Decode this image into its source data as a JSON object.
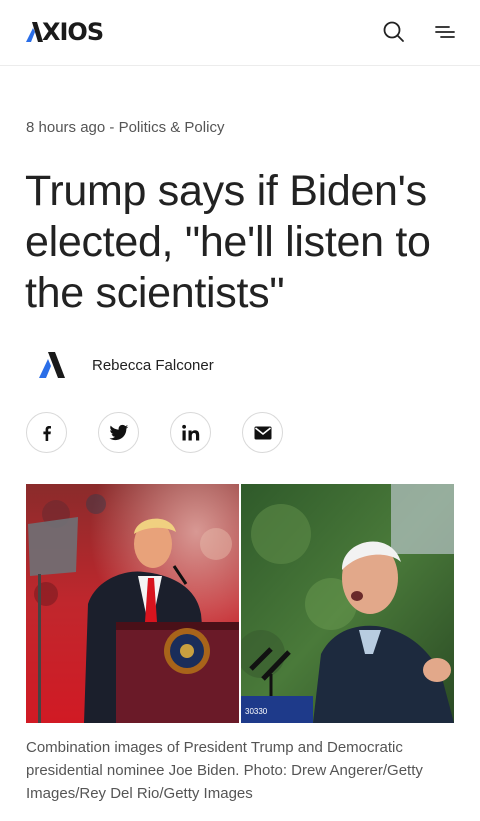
{
  "header": {
    "logo_text": "XIOS",
    "search_icon": "search-icon",
    "menu_icon": "menu-icon"
  },
  "article": {
    "time_ago": "8 hours ago",
    "separator": " - ",
    "category": "Politics & Policy",
    "headline": "Trump says if Biden's elected, \"he'll listen to the scientists\"",
    "author": "Rebecca Falconer",
    "share_buttons": [
      "facebook-icon",
      "twitter-icon",
      "linkedin-icon",
      "email-icon"
    ],
    "photo": {
      "podium_number": "30330"
    },
    "caption": "Combination images of President Trump and Democratic presidential nominee Joe Biden. Photo: Drew Angerer/Getty Images/Rey Del Rio/Getty Images"
  },
  "colors": {
    "accent_blue": "#2a6ee8",
    "text_dark": "#222222",
    "text_muted": "#555555",
    "border": "#d9d9d9"
  }
}
